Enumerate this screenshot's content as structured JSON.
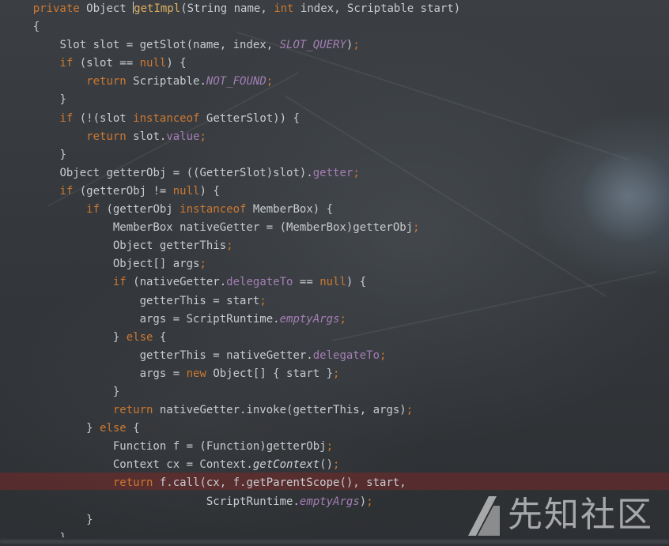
{
  "editor": {
    "lines": [
      {
        "indent": 4,
        "parts": [
          [
            "kw",
            "private "
          ],
          [
            "t",
            "Object "
          ],
          [
            "cursor",
            ""
          ],
          [
            "fn",
            "getImpl"
          ],
          [
            "t",
            "(String name, "
          ],
          [
            "kw",
            "int "
          ],
          [
            "t",
            "index, Scriptable start)"
          ]
        ]
      },
      {
        "indent": 4,
        "parts": [
          [
            "t",
            "{"
          ]
        ]
      },
      {
        "indent": 8,
        "parts": [
          [
            "t",
            "Slot slot = getSlot(name, index, "
          ],
          [
            "it",
            "SLOT_QUERY"
          ],
          [
            "t",
            ")"
          ],
          [
            "sc",
            ";"
          ]
        ]
      },
      {
        "indent": 8,
        "parts": [
          [
            "kw",
            "if "
          ],
          [
            "t",
            "(slot == "
          ],
          [
            "kw",
            "null"
          ],
          [
            "t",
            ") {"
          ]
        ]
      },
      {
        "indent": 12,
        "parts": [
          [
            "kw",
            "return "
          ],
          [
            "t",
            "Scriptable."
          ],
          [
            "it",
            "NOT_FOUND"
          ],
          [
            "sc",
            ";"
          ]
        ]
      },
      {
        "indent": 8,
        "parts": [
          [
            "t",
            "}"
          ]
        ]
      },
      {
        "indent": 8,
        "parts": [
          [
            "kw",
            "if "
          ],
          [
            "t",
            "(!(slot "
          ],
          [
            "kw",
            "instanceof "
          ],
          [
            "t",
            "GetterSlot)) {"
          ]
        ]
      },
      {
        "indent": 12,
        "parts": [
          [
            "kw",
            "return "
          ],
          [
            "t",
            "slot."
          ],
          [
            "fld",
            "value"
          ],
          [
            "sc",
            ";"
          ]
        ]
      },
      {
        "indent": 8,
        "parts": [
          [
            "t",
            "}"
          ]
        ]
      },
      {
        "indent": 8,
        "parts": [
          [
            "t",
            "Object getterObj = ((GetterSlot)slot)."
          ],
          [
            "fld",
            "getter"
          ],
          [
            "sc",
            ";"
          ]
        ]
      },
      {
        "indent": 8,
        "parts": [
          [
            "kw",
            "if "
          ],
          [
            "t",
            "(getterObj != "
          ],
          [
            "kw",
            "null"
          ],
          [
            "t",
            ") {"
          ]
        ]
      },
      {
        "indent": 12,
        "parts": [
          [
            "kw",
            "if "
          ],
          [
            "t",
            "(getterObj "
          ],
          [
            "kw",
            "instanceof "
          ],
          [
            "t",
            "MemberBox) {"
          ]
        ]
      },
      {
        "indent": 16,
        "parts": [
          [
            "t",
            "MemberBox nativeGetter = (MemberBox)getterObj"
          ],
          [
            "sc",
            ";"
          ]
        ]
      },
      {
        "indent": 16,
        "parts": [
          [
            "t",
            "Object getterThis"
          ],
          [
            "sc",
            ";"
          ]
        ]
      },
      {
        "indent": 16,
        "parts": [
          [
            "t",
            "Object[] args"
          ],
          [
            "sc",
            ";"
          ]
        ]
      },
      {
        "indent": 16,
        "parts": [
          [
            "kw",
            "if "
          ],
          [
            "t",
            "(nativeGetter."
          ],
          [
            "fld",
            "delegateTo"
          ],
          [
            "t",
            " == "
          ],
          [
            "kw",
            "null"
          ],
          [
            "t",
            ") {"
          ]
        ]
      },
      {
        "indent": 20,
        "parts": [
          [
            "t",
            "getterThis = start"
          ],
          [
            "sc",
            ";"
          ]
        ]
      },
      {
        "indent": 20,
        "parts": [
          [
            "t",
            "args = ScriptRuntime."
          ],
          [
            "it",
            "emptyArgs"
          ],
          [
            "sc",
            ";"
          ]
        ]
      },
      {
        "indent": 16,
        "parts": [
          [
            "t",
            "} "
          ],
          [
            "kw",
            "else "
          ],
          [
            "t",
            "{"
          ]
        ]
      },
      {
        "indent": 20,
        "parts": [
          [
            "t",
            "getterThis = nativeGetter."
          ],
          [
            "fld",
            "delegateTo"
          ],
          [
            "sc",
            ";"
          ]
        ]
      },
      {
        "indent": 20,
        "parts": [
          [
            "t",
            "args = "
          ],
          [
            "kw",
            "new "
          ],
          [
            "t",
            "Object[] { start }"
          ],
          [
            "sc",
            ";"
          ]
        ]
      },
      {
        "indent": 16,
        "parts": [
          [
            "t",
            "}"
          ]
        ]
      },
      {
        "indent": 16,
        "parts": [
          [
            "kw",
            "return "
          ],
          [
            "t",
            "nativeGetter.invoke(getterThis, args)"
          ],
          [
            "sc",
            ";"
          ]
        ]
      },
      {
        "indent": 12,
        "parts": [
          [
            "t",
            "} "
          ],
          [
            "kw",
            "else "
          ],
          [
            "t",
            "{"
          ]
        ]
      },
      {
        "indent": 16,
        "parts": [
          [
            "t",
            "Function f = (Function)getterObj"
          ],
          [
            "sc",
            ";"
          ]
        ]
      },
      {
        "indent": 16,
        "parts": [
          [
            "t",
            "Context cx = Context."
          ],
          [
            "itc",
            "getContext"
          ],
          [
            "t",
            "()"
          ],
          [
            "sc",
            ";"
          ]
        ]
      },
      {
        "indent": 16,
        "parts": [
          [
            "kw",
            "return "
          ],
          [
            "t",
            "f.call(cx, f.getParentScope(), start,"
          ]
        ]
      },
      {
        "indent": 30,
        "parts": [
          [
            "t",
            "ScriptRuntime."
          ],
          [
            "it",
            "emptyArgs"
          ],
          [
            "t",
            ")"
          ],
          [
            "sc",
            ";"
          ]
        ]
      },
      {
        "indent": 12,
        "parts": [
          [
            "t",
            "}"
          ]
        ]
      },
      {
        "indent": 8,
        "parts": [
          [
            "t",
            "}"
          ]
        ]
      }
    ]
  },
  "watermark": {
    "text": "先知社区"
  }
}
